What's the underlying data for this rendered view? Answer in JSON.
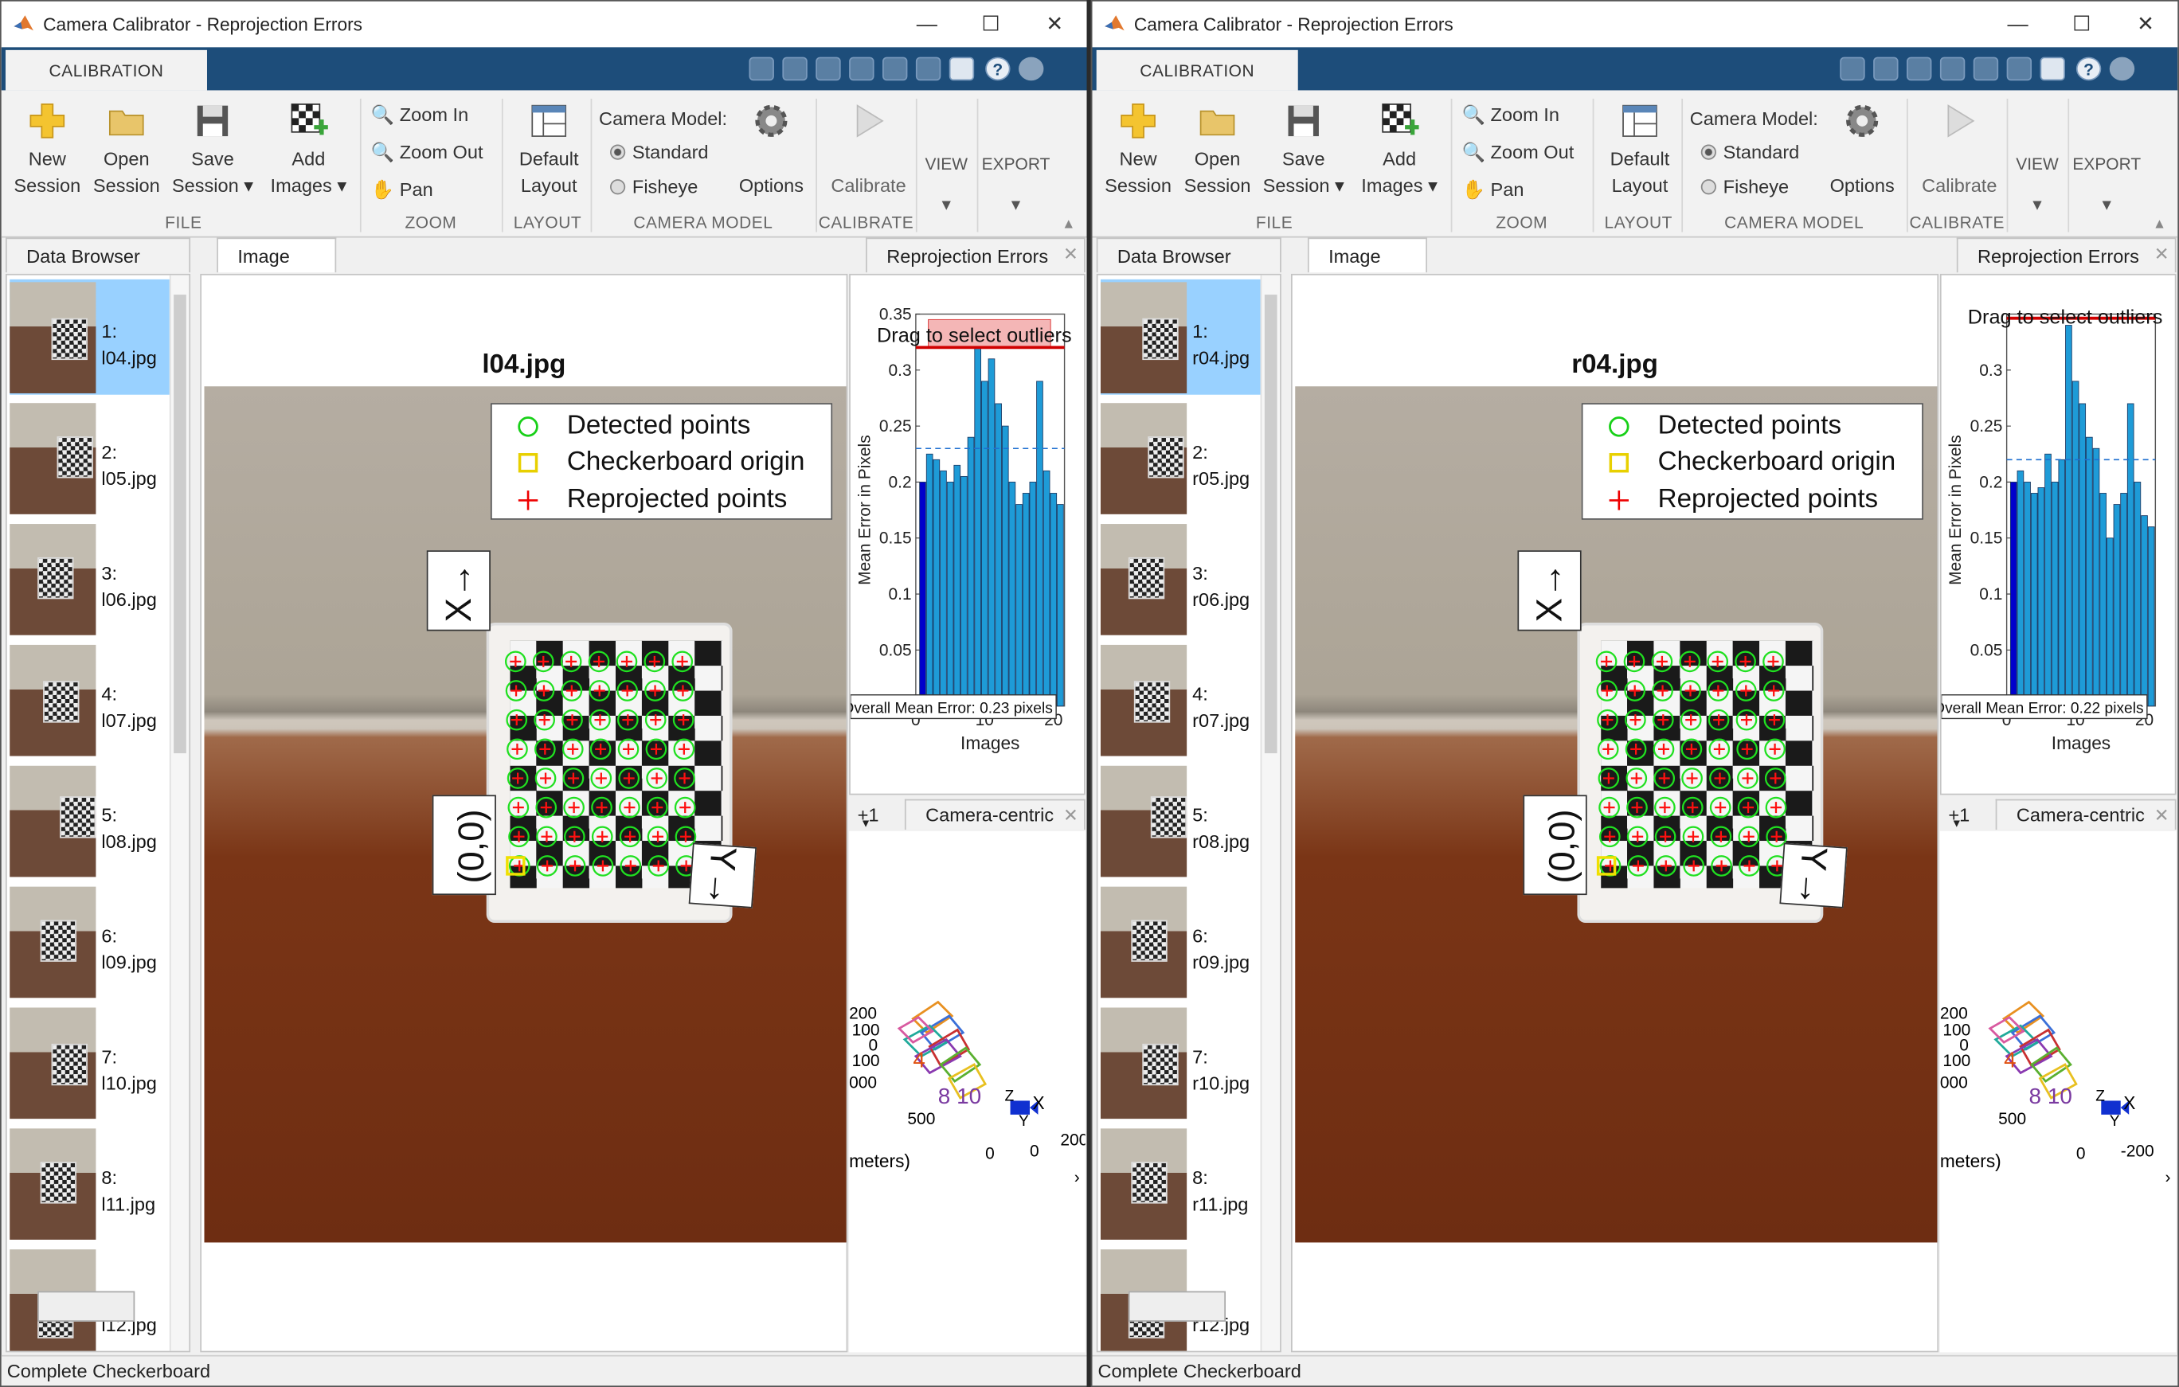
{
  "windows": [
    {
      "title": "Camera Calibrator - Reprojection Errors",
      "window_controls": {
        "minimize": "—",
        "maximize": "☐",
        "close": "✕"
      },
      "ribbon_tab": "CALIBRATION",
      "file": {
        "new_session": [
          "New",
          "Session"
        ],
        "open_session": [
          "Open",
          "Session"
        ],
        "save_session": [
          "Save",
          "Session ▾"
        ],
        "add_images": [
          "Add",
          "Images ▾"
        ],
        "group": "FILE"
      },
      "zoom": {
        "zoom_in": "Zoom In",
        "zoom_out": "Zoom Out",
        "pan": "Pan",
        "group": "ZOOM"
      },
      "layout": {
        "default_layout": [
          "Default",
          "Layout"
        ],
        "group": "LAYOUT"
      },
      "camera_model": {
        "label": "Camera Model:",
        "standard": "Standard",
        "fisheye": "Fisheye",
        "options": "Options",
        "group": "CAMERA MODEL"
      },
      "calibrate": {
        "label": "Calibrate",
        "group": "CALIBRATE"
      },
      "view": "VIEW",
      "export": "EXPORT",
      "tabs": {
        "data_browser": "Data Browser",
        "image": "Image",
        "reprojection": "Reprojection Errors",
        "plus1": "+1",
        "camera_centric": "Camera-centric"
      },
      "thumbnails": [
        {
          "num": "1:",
          "name": "l04.jpg",
          "selected": true
        },
        {
          "num": "2:",
          "name": "l05.jpg"
        },
        {
          "num": "3:",
          "name": "l06.jpg"
        },
        {
          "num": "4:",
          "name": "l07.jpg"
        },
        {
          "num": "5:",
          "name": "l08.jpg"
        },
        {
          "num": "6:",
          "name": "l09.jpg"
        },
        {
          "num": "7:",
          "name": "l10.jpg"
        },
        {
          "num": "8:",
          "name": "l11.jpg"
        },
        {
          "num": "",
          "name": "l12.jpg"
        }
      ],
      "image_title": "l04.jpg",
      "legend": {
        "detected": "Detected points",
        "origin": "Checkerboard origin",
        "reprojected": "Reprojected points"
      },
      "axis_labels": {
        "x": "X→",
        "y": "Y→",
        "origin": "(0,0)"
      },
      "chart": {
        "drag_text": "Drag to select outliers",
        "ylabel": "Mean Error in Pixels",
        "xlabel": "Images",
        "overall": "Overall Mean Error: 0.23 pixels"
      },
      "extrinsics": {
        "ticks_left": [
          "200",
          "100",
          "0",
          "100",
          "000"
        ],
        "tick_500": "500",
        "tick_0a": "0",
        "tick_0b": "0",
        "tick_right": "200",
        "ylabel_fragment": "meters)",
        "nums": "8 10",
        "num4": "4",
        "axis_x": "X",
        "axis_y": "Y",
        "axis_z": "Z"
      },
      "status": "Complete Checkerboard"
    },
    {
      "title": "Camera Calibrator - Reprojection Errors",
      "window_controls": {
        "minimize": "—",
        "maximize": "☐",
        "close": "✕"
      },
      "ribbon_tab": "CALIBRATION",
      "file": {
        "new_session": [
          "New",
          "Session"
        ],
        "open_session": [
          "Open",
          "Session"
        ],
        "save_session": [
          "Save",
          "Session ▾"
        ],
        "add_images": [
          "Add",
          "Images ▾"
        ],
        "group": "FILE"
      },
      "zoom": {
        "zoom_in": "Zoom In",
        "zoom_out": "Zoom Out",
        "pan": "Pan",
        "group": "ZOOM"
      },
      "layout": {
        "default_layout": [
          "Default",
          "Layout"
        ],
        "group": "LAYOUT"
      },
      "camera_model": {
        "label": "Camera Model:",
        "standard": "Standard",
        "fisheye": "Fisheye",
        "options": "Options",
        "group": "CAMERA MODEL"
      },
      "calibrate": {
        "label": "Calibrate",
        "group": "CALIBRATE"
      },
      "view": "VIEW",
      "export": "EXPORT",
      "tabs": {
        "data_browser": "Data Browser",
        "image": "Image",
        "reprojection": "Reprojection Errors",
        "plus1": "+1",
        "camera_centric": "Camera-centric"
      },
      "thumbnails": [
        {
          "num": "1:",
          "name": "r04.jpg",
          "selected": true
        },
        {
          "num": "2:",
          "name": "r05.jpg"
        },
        {
          "num": "3:",
          "name": "r06.jpg"
        },
        {
          "num": "4:",
          "name": "r07.jpg"
        },
        {
          "num": "5:",
          "name": "r08.jpg"
        },
        {
          "num": "6:",
          "name": "r09.jpg"
        },
        {
          "num": "7:",
          "name": "r10.jpg"
        },
        {
          "num": "8:",
          "name": "r11.jpg"
        },
        {
          "num": "",
          "name": "r12.jpg"
        }
      ],
      "image_title": "r04.jpg",
      "legend": {
        "detected": "Detected points",
        "origin": "Checkerboard origin",
        "reprojected": "Reprojected points"
      },
      "axis_labels": {
        "x": "X→",
        "y": "Y→",
        "origin": "(0,0)"
      },
      "chart": {
        "drag_text": "Drag to select outliers",
        "ylabel": "Mean Error in Pixels",
        "xlabel": "Images",
        "overall": "Overall Mean Error: 0.22 pixels"
      },
      "extrinsics": {
        "ticks_left": [
          "200",
          "100",
          "0",
          "100",
          "000"
        ],
        "tick_500": "500",
        "tick_0a": "0",
        "tick_0b": "-200",
        "tick_right": "",
        "ylabel_fragment": "meters)",
        "nums": "8 10",
        "num4": "4",
        "axis_x": "X",
        "axis_y": "Y",
        "axis_z": "Z"
      },
      "status": "Complete Checkerboard"
    }
  ],
  "chart_data": [
    {
      "type": "bar",
      "ylabel": "Mean Error in Pixels",
      "xlabel": "Images",
      "ylim": [
        0,
        0.35
      ],
      "yticks": [
        0.05,
        0.1,
        0.15,
        0.2,
        0.25,
        0.3,
        0.35
      ],
      "xticks": [
        0,
        10,
        20
      ],
      "x": [
        1,
        2,
        3,
        4,
        5,
        6,
        7,
        8,
        9,
        10,
        11,
        12,
        13,
        14,
        15,
        16,
        17,
        18,
        19,
        20,
        21
      ],
      "values": [
        0.2,
        0.225,
        0.22,
        0.21,
        0.2,
        0.215,
        0.205,
        0.24,
        0.32,
        0.29,
        0.31,
        0.27,
        0.25,
        0.2,
        0.18,
        0.19,
        0.2,
        0.29,
        0.21,
        0.19,
        0.18
      ],
      "highlighted_index": 0,
      "overall_mean": 0.23,
      "colors": {
        "bar": "#1e9bd7",
        "selected_bar": "#0000cc",
        "mean_line": "#1e6fd0",
        "selection": "#f4b6b6"
      }
    },
    {
      "type": "bar",
      "ylabel": "Mean Error in Pixels",
      "xlabel": "Images",
      "ylim": [
        0,
        0.35
      ],
      "yticks": [
        0.05,
        0.1,
        0.15,
        0.2,
        0.25,
        0.3
      ],
      "xticks": [
        0,
        10,
        20
      ],
      "x": [
        1,
        2,
        3,
        4,
        5,
        6,
        7,
        8,
        9,
        10,
        11,
        12,
        13,
        14,
        15,
        16,
        17,
        18,
        19,
        20,
        21
      ],
      "values": [
        0.2,
        0.21,
        0.2,
        0.19,
        0.195,
        0.225,
        0.2,
        0.22,
        0.34,
        0.29,
        0.27,
        0.24,
        0.23,
        0.19,
        0.15,
        0.18,
        0.19,
        0.27,
        0.2,
        0.17,
        0.16
      ],
      "highlighted_index": 0,
      "overall_mean": 0.22,
      "colors": {
        "bar": "#1e9bd7",
        "selected_bar": "#0000cc",
        "mean_line": "#1e6fd0",
        "selection": "#f4b6b6"
      }
    }
  ]
}
